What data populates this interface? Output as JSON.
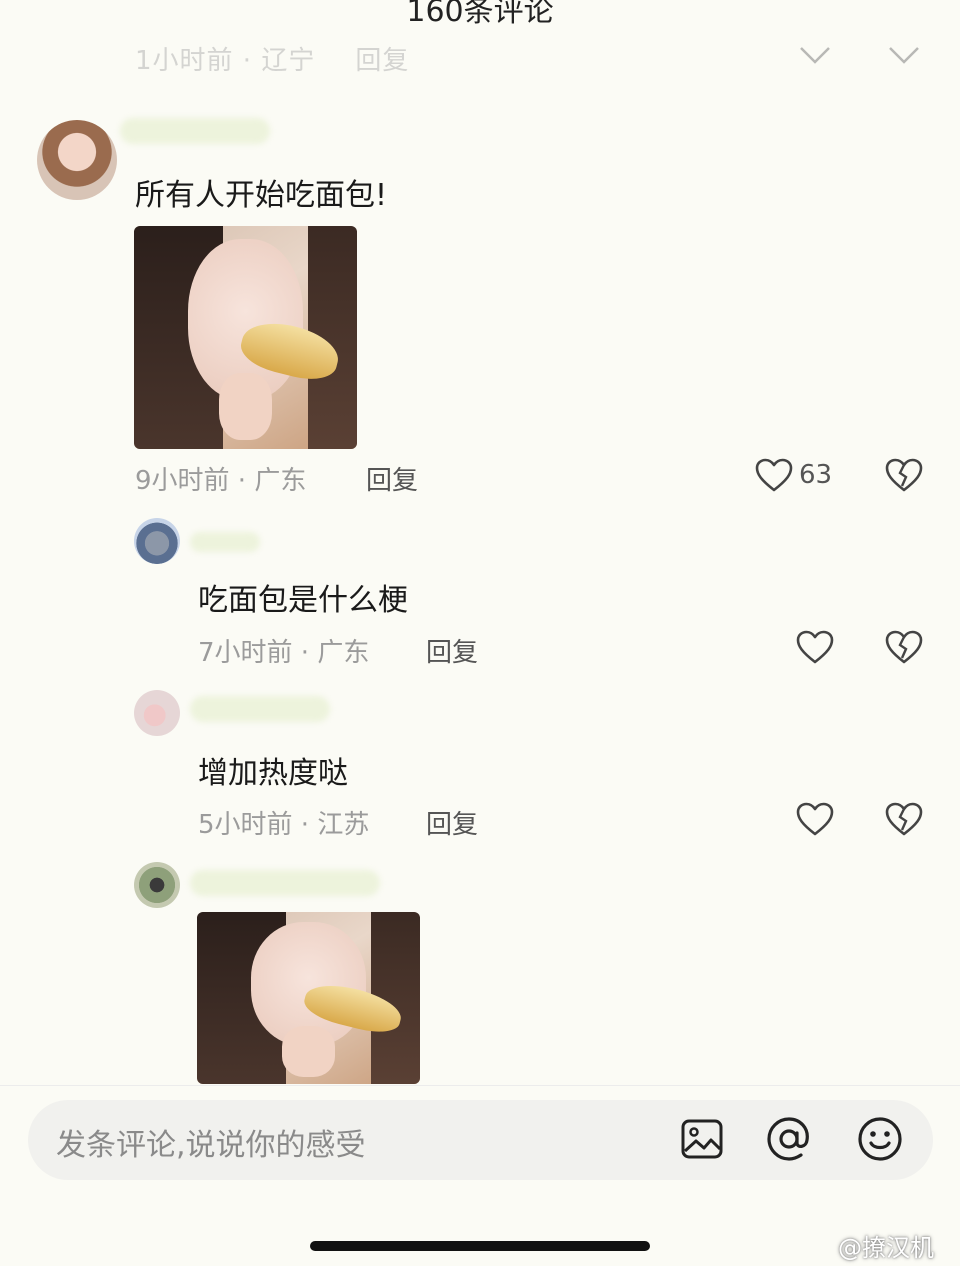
{
  "header": {
    "title": "160条评论"
  },
  "previous_comment_meta": {
    "time_loc": "1小时前 · 辽宁",
    "reply": "回复"
  },
  "comment": {
    "text": "所有人开始吃面包!",
    "time_loc": "9小时前 · 广东",
    "reply": "回复",
    "likes": "63"
  },
  "replies": [
    {
      "text": "吃面包是什么梗",
      "time_loc": "7小时前 · 广东",
      "reply": "回复"
    },
    {
      "text": "增加热度哒",
      "time_loc": "5小时前 · 江苏",
      "reply": "回复"
    }
  ],
  "input": {
    "placeholder": "发条评论,说说你的感受"
  },
  "watermark": "@撩汉机",
  "icons": [
    "heart-icon",
    "broken-heart-icon",
    "image-icon",
    "at-icon",
    "emoji-icon"
  ]
}
